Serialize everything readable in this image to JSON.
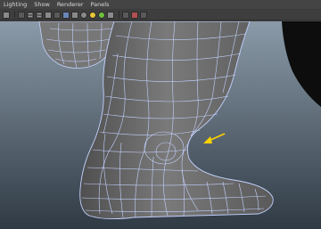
{
  "menu": {
    "items": [
      "Lighting",
      "Show",
      "Renderer",
      "Panels"
    ]
  },
  "toolbar": {
    "icons": [
      "camera-icon",
      "separator",
      "bookmark-icon",
      "grid-view-icon",
      "wireframe-icon",
      "smooth-shade-icon",
      "flat-shade-icon",
      "texture-icon",
      "lighting-icon",
      "separator",
      "gear-icon",
      "shadow-icon",
      "light-icon",
      "separator",
      "xray-icon",
      "isolate-icon",
      "resolution-gate-icon"
    ]
  },
  "viewport": {
    "background_top": "#8b9aa8",
    "background_bottom": "#2f3a44",
    "mesh_fill": "#6d6d6d",
    "wire_color": "#b8c8ff",
    "arrow_color": "#ffd200"
  }
}
